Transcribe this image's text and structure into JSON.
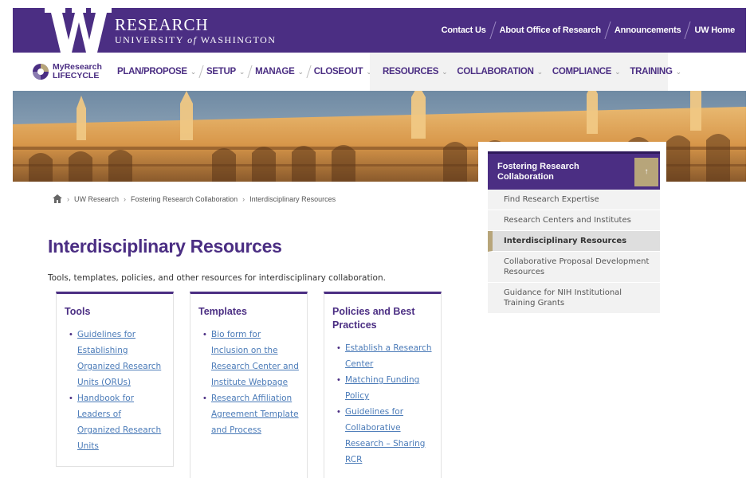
{
  "header": {
    "brand_line1": "RESEARCH",
    "brand_line2_pre": "UNIVERSITY ",
    "brand_line2_of": "of",
    "brand_line2_post": " WASHINGTON",
    "links": [
      "Contact Us",
      "About Office of Research",
      "Announcements",
      "UW Home"
    ]
  },
  "nav": {
    "lifecycle_line1": "MyResearch",
    "lifecycle_line2": "LIFECYCLE",
    "primary": [
      "PLAN/PROPOSE",
      "SETUP",
      "MANAGE",
      "CLOSEOUT"
    ],
    "secondary": [
      "RESOURCES",
      "COLLABORATION",
      "COMPLIANCE",
      "TRAINING"
    ]
  },
  "breadcrumb": {
    "items": [
      "UW Research",
      "Fostering Research Collaboration",
      "Interdisciplinary Resources"
    ]
  },
  "page": {
    "title": "Interdisciplinary Resources",
    "intro": "Tools, templates, policies, and other resources for interdisciplinary collaboration."
  },
  "cards": [
    {
      "title": "Tools",
      "links": [
        "Guidelines for Establishing Organized Research Units (ORUs)",
        "Handbook for Leaders of Organized Research Units"
      ]
    },
    {
      "title": "Templates",
      "links": [
        "Bio form for Inclusion on the Research Center and Institute Webpage",
        "Research Affiliation Agreement Template and Process"
      ]
    },
    {
      "title": "Policies and Best Practices",
      "links": [
        "Establish a Research Center",
        "Matching Funding Policy",
        "Guidelines for Collaborative Research – Sharing RCR"
      ]
    }
  ],
  "sidebar": {
    "title": "Fostering Research Collaboration",
    "items": [
      "Find Research Expertise",
      "Research Centers and Institutes",
      "Interdisciplinary Resources",
      "Collaborative Proposal Development Resources",
      "Guidance for NIH Institutional Training Grants"
    ]
  },
  "colors": {
    "uw_purple": "#4b2e83",
    "uw_gold": "#b7a57a",
    "link_blue": "#4b7bb8"
  }
}
